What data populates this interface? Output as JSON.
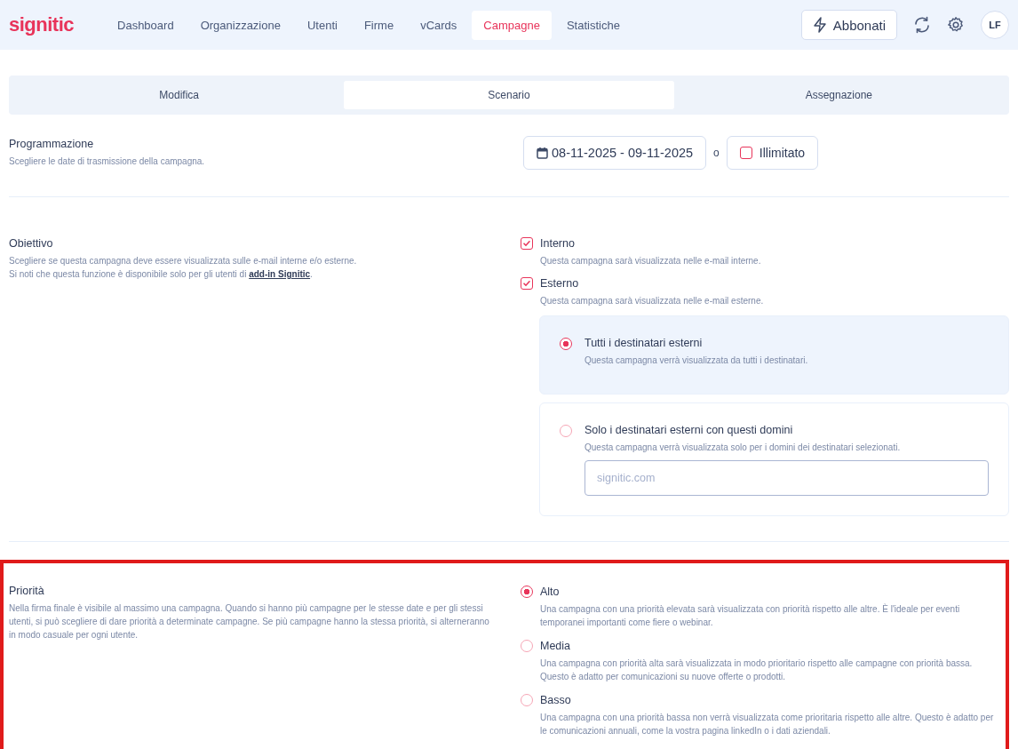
{
  "nav": {
    "logo": "signitic",
    "items": [
      {
        "label": "Dashboard",
        "selected": false
      },
      {
        "label": "Organizzazione",
        "selected": false
      },
      {
        "label": "Utenti",
        "selected": false
      },
      {
        "label": "Firme",
        "selected": false
      },
      {
        "label": "vCards",
        "selected": false
      },
      {
        "label": "Campagne",
        "selected": true
      },
      {
        "label": "Statistiche",
        "selected": false
      }
    ],
    "subscribe": "Abbonati",
    "avatar": "LF"
  },
  "tabs": [
    {
      "label": "Modifica",
      "selected": false
    },
    {
      "label": "Scenario",
      "selected": true
    },
    {
      "label": "Assegnazione",
      "selected": false
    }
  ],
  "scheduling": {
    "title": "Programmazione",
    "description": "Scegliere le date di trasmissione della campagna.",
    "date_range": "08-11-2025 - 09-11-2025",
    "separator": "o",
    "unlimited": {
      "label": "Illimitato",
      "checked": false
    }
  },
  "target": {
    "title": "Obiettivo",
    "description_line": "Scegliere se questa campagna deve essere visualizzata sulle e-mail interne e/o esterne.",
    "note_before": "Si noti che questa funzione è disponibile solo per gli utenti di ",
    "note_link": "add-in Signitic",
    "note_after": ".",
    "options": [
      {
        "label": "Interno",
        "description": "Questa campagna sarà visualizzata nelle e-mail interne.",
        "checked": true
      },
      {
        "label": "Esterno",
        "description": "Questa campagna sarà visualizzata nelle e-mail esterne.",
        "checked": true
      }
    ],
    "recipients": [
      {
        "label": "Tutti i destinatari esterni",
        "description": "Questa campagna verrà visualizzata da tutti i destinatari.",
        "selected": true
      },
      {
        "label": "Solo i destinatari esterni con questi domini",
        "description": "Questa campagna verrà visualizzata solo per i domini dei destinatari selezionati.",
        "selected": false,
        "placeholder": "signitic.com"
      }
    ]
  },
  "priority": {
    "title": "Priorità",
    "description": "Nella firma finale è visibile al massimo una campagna. Quando si hanno più campagne per le stesse date e per gli stessi utenti, si può scegliere di dare priorità a determinate campagne. Se più campagne hanno la stessa priorità, si alterneranno in modo casuale per ogni utente.",
    "highlighted": true,
    "options": [
      {
        "label": "Alto",
        "description": "Una campagna con una priorità elevata sarà visualizzata con priorità rispetto alle altre. È l'ideale per eventi temporanei importanti come fiere o webinar.",
        "selected": true
      },
      {
        "label": "Media",
        "description": "Una campagna con priorità alta sarà visualizzata in modo prioritario rispetto alle campagne con priorità bassa. Questo è adatto per comunicazioni su nuove offerte o prodotti.",
        "selected": false
      },
      {
        "label": "Basso",
        "description": "Una campagna con una priorità bassa non verrà visualizzata come prioritaria rispetto alle altre. Questo è adatto per le comunicazioni annuali, come la vostra pagina linkedIn o i dati aziendali.",
        "selected": false
      }
    ]
  }
}
